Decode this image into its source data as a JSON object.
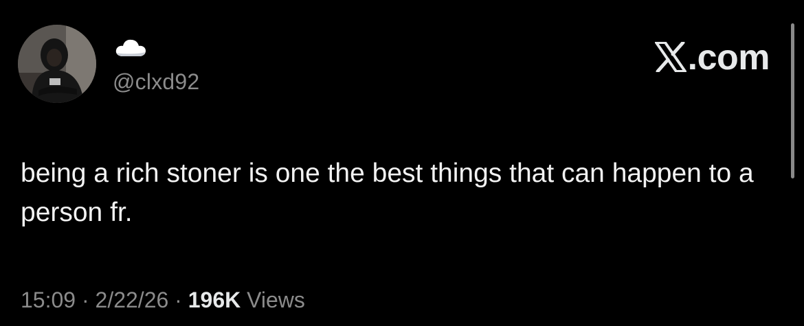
{
  "user": {
    "display_name_icon": "cloud-emoji",
    "handle": "@clxd92"
  },
  "brand": {
    "label": ".com",
    "icon": "x-logo-icon"
  },
  "tweet": {
    "text": "being a rich stoner is one the best things that can happen to a person fr."
  },
  "meta": {
    "time": "15:09",
    "sep1": " · ",
    "date": "2/22/26",
    "sep2": " · ",
    "views_count": "196K",
    "views_label": " Views"
  },
  "colors": {
    "background": "#000000",
    "primary_text": "#e7e9ea",
    "secondary_text": "#8b8b8b"
  }
}
